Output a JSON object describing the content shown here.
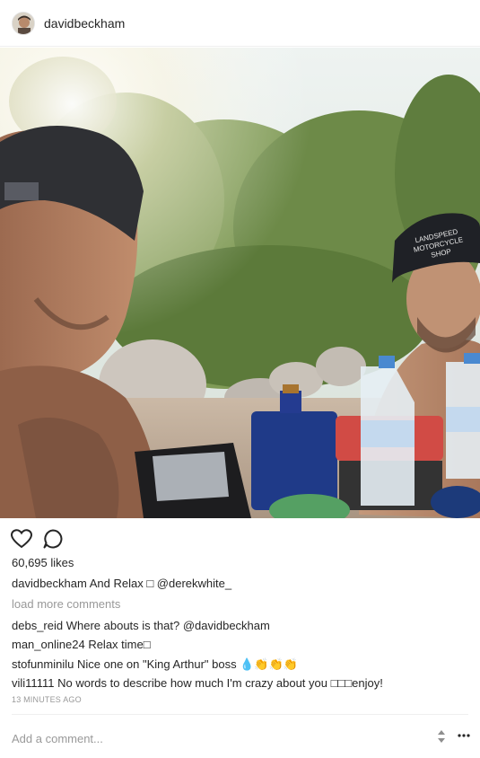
{
  "header": {
    "username": "davidbeckham"
  },
  "photo": {
    "cap_left_text": "",
    "cap_right_text": "LANDSPEED MOTORCYCLE SHOP"
  },
  "actions": {
    "like_icon": "heart-icon",
    "comment_icon": "comment-icon"
  },
  "likes_text": "60,695 likes",
  "caption": {
    "user": "davidbeckham",
    "text": "And Relax □ ",
    "mention": "@derekwhite_"
  },
  "load_more": "load more comments",
  "comments": [
    {
      "user": "debs_reid",
      "text": "Where abouts is that? ",
      "mention": "@davidbeckham"
    },
    {
      "user": "man_online24",
      "text": "Relax time□",
      "mention": ""
    },
    {
      "user": "stofunminilu",
      "text": "Nice one on \"King Arthur\" boss 💧👏👏👏",
      "mention": ""
    },
    {
      "user": "vili11111",
      "text": "No words to describe how much I'm crazy about you □□□enjoy!",
      "mention": ""
    }
  ],
  "timestamp": "13 MINUTES AGO",
  "add_comment": {
    "placeholder": "Add a comment..."
  }
}
